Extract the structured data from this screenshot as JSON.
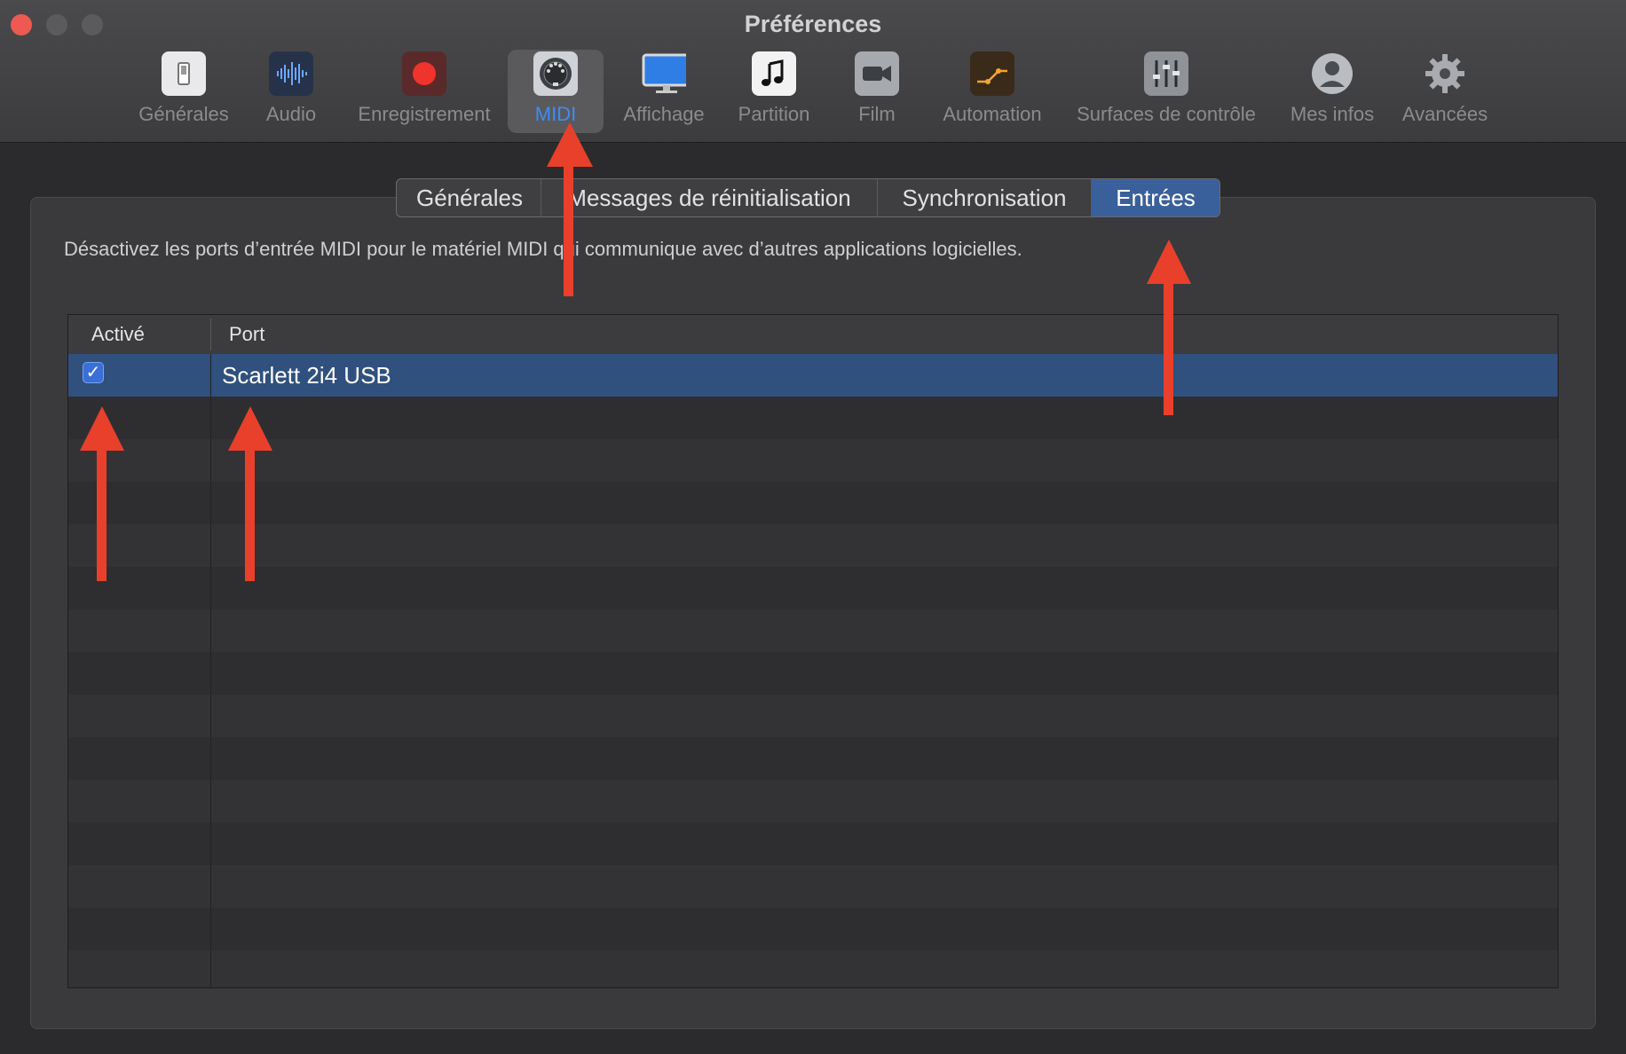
{
  "window": {
    "title": "Préférences"
  },
  "toolbar": {
    "items": [
      {
        "label": "Générales",
        "icon": "switch-icon"
      },
      {
        "label": "Audio",
        "icon": "waveform-icon"
      },
      {
        "label": "Enregistrement",
        "icon": "record-icon"
      },
      {
        "label": "MIDI",
        "icon": "midi-connector-icon",
        "selected": true
      },
      {
        "label": "Affichage",
        "icon": "monitor-icon"
      },
      {
        "label": "Partition",
        "icon": "music-note-icon"
      },
      {
        "label": "Film",
        "icon": "video-camera-icon"
      },
      {
        "label": "Automation",
        "icon": "automation-curve-icon"
      },
      {
        "label": "Surfaces de contrôle",
        "icon": "faders-icon"
      },
      {
        "label": "Mes infos",
        "icon": "user-icon"
      },
      {
        "label": "Avancées",
        "icon": "gear-icon"
      }
    ]
  },
  "tabs": [
    {
      "label": "Générales"
    },
    {
      "label": "Messages de réinitialisation"
    },
    {
      "label": "Synchronisation"
    },
    {
      "label": "Entrées",
      "active": true
    }
  ],
  "description": "Désactivez les ports d’entrée MIDI pour le matériel MIDI qui communique avec d’autres applications logicielles.",
  "table": {
    "headers": {
      "enabled": "Activé",
      "port": "Port"
    },
    "rows": [
      {
        "enabled": true,
        "checkmark": "✓",
        "port": "Scarlett 2i4 USB"
      }
    ]
  },
  "colors": {
    "accent": "#3d8cf5",
    "selected_tab": "#3a609b",
    "selected_row": "#30507e",
    "annotation_arrow": "#e8402b"
  }
}
